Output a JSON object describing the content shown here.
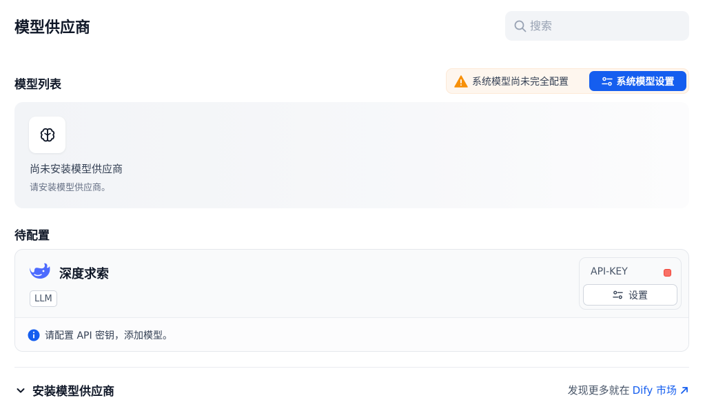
{
  "header": {
    "title": "模型供应商",
    "search_placeholder": "搜索"
  },
  "model_list": {
    "title": "模型列表",
    "warning_text": "系统模型尚未完全配置",
    "system_settings_label": "系统模型设置",
    "empty_title": "尚未安装模型供应商",
    "empty_subtitle": "请安装模型供应商。"
  },
  "pending": {
    "title": "待配置",
    "provider": {
      "name": "深度求索",
      "tag": "LLM",
      "api_key_label": "API-KEY",
      "setup_label": "设置",
      "footer_text": "请配置 API 密钥，添加模型。"
    }
  },
  "install": {
    "title": "安装模型供应商",
    "discover_prefix": "发现更多就在",
    "marketplace_name": "Dify 市场"
  },
  "colors": {
    "accent": "#155eef",
    "warning": "#f79009",
    "status_dot": "#f97066"
  }
}
